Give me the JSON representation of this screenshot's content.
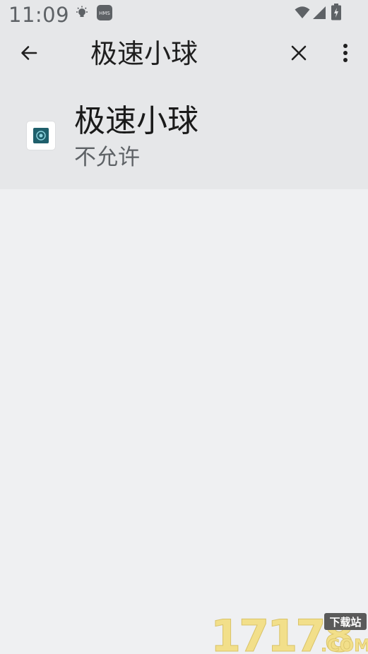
{
  "status_bar": {
    "time": "11:09",
    "icons": [
      "bulb-icon",
      "hms-icon",
      "wifi-icon",
      "cell-signal-icon",
      "battery-charging-icon"
    ],
    "hms_label": "HMS"
  },
  "app_bar": {
    "search_query": "极速小球",
    "icons": [
      "back-arrow-icon",
      "close-icon",
      "more-vert-icon"
    ]
  },
  "results": [
    {
      "app_name": "极速小球",
      "permission_status": "不允许",
      "icon": "app-icon"
    }
  ],
  "watermark": {
    "brand": "17178",
    "domain": ".COM",
    "tag": "下载站"
  },
  "colors": {
    "background": "#eff0f2",
    "bar_background": "#e6e7e9",
    "primary_text": "#1a1a1a",
    "secondary_text": "#5e6266",
    "app_icon_teal": "#1f5f6b",
    "watermark_yellow": "#f2df8a"
  }
}
